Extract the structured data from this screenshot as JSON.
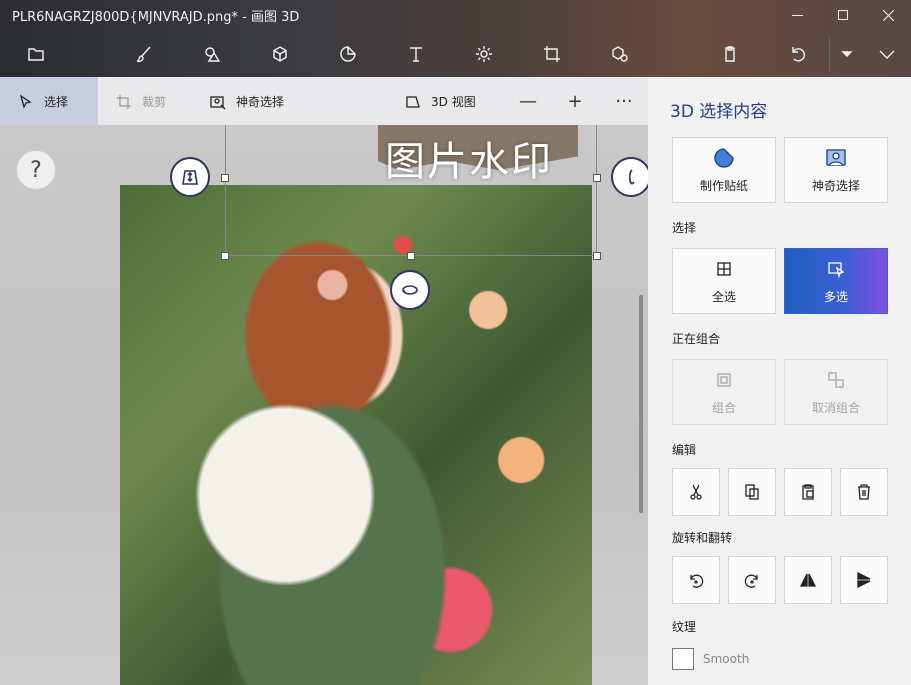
{
  "window": {
    "title": "PLR6NAGRZJ800D{MJNVRAJD.png* - 画图 3D",
    "controls": [
      "minimize-icon",
      "maximize-icon",
      "close-icon"
    ]
  },
  "toolbar": {
    "icons": [
      "folder-icon",
      "brush-icon",
      "shapes-2d-icon",
      "cube-3d-icon",
      "sticker-icon",
      "text-icon",
      "effects-icon",
      "crop-canvas-icon",
      "mixed-reality-icon",
      "paste-icon",
      "undo-icon",
      "dropdown-icon",
      "collapse-icon"
    ]
  },
  "subbar": {
    "select_label": "选择",
    "crop_label": "裁剪",
    "magic_select_label": "神奇选择",
    "view3d_label": "3D 视图",
    "zoom_out": "—",
    "zoom_in": "+",
    "more": "···"
  },
  "canvas": {
    "help": "?",
    "watermark": "图片水印"
  },
  "panel": {
    "title": "3D 选择内容",
    "make_sticker": "制作贴纸",
    "magic_select": "神奇选择",
    "select_section": "选择",
    "select_all": "全选",
    "multi_select": "多选",
    "grouping_section": "正在组合",
    "group": "组合",
    "ungroup": "取消组合",
    "edit_section": "编辑",
    "rotate_section": "旋转和翻转",
    "texture_section": "纹理",
    "smooth_label": "Smooth",
    "smooth_checked": false
  }
}
